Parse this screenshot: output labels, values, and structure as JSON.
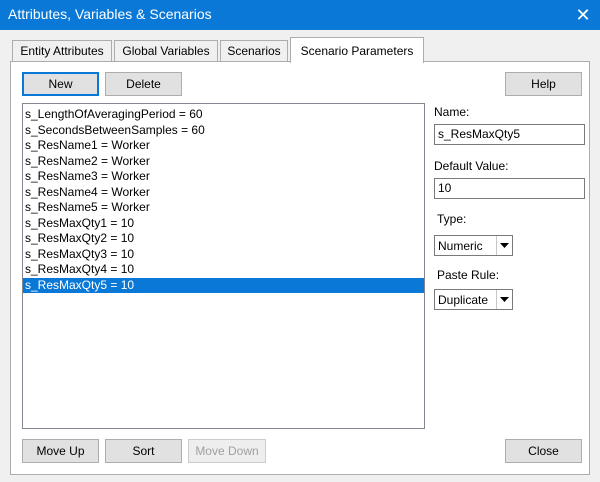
{
  "window": {
    "title": "Attributes, Variables & Scenarios",
    "close_glyph": "✕"
  },
  "tabs": [
    {
      "label": "Entity Attributes"
    },
    {
      "label": "Global Variables"
    },
    {
      "label": "Scenarios"
    },
    {
      "label": "Scenario Parameters",
      "active": true
    }
  ],
  "toolbar": {
    "new_label": "New",
    "delete_label": "Delete",
    "help_label": "Help"
  },
  "parameters": {
    "items": [
      "s_LengthOfAveragingPeriod = 60",
      "s_SecondsBetweenSamples = 60",
      "s_ResName1 = Worker",
      "s_ResName2 = Worker",
      "s_ResName3 = Worker",
      "s_ResName4 = Worker",
      "s_ResName5 = Worker",
      "s_ResMaxQty1 = 10",
      "s_ResMaxQty2 = 10",
      "s_ResMaxQty3 = 10",
      "s_ResMaxQty4 = 10",
      "s_ResMaxQty5 = 10"
    ],
    "selected_index": 11
  },
  "form": {
    "name_label": "Name:",
    "name_value": "s_ResMaxQty5",
    "default_label": "Default Value:",
    "default_value": "10",
    "type_label": "Type:",
    "type_value": "Numeric",
    "paste_label": "Paste Rule:",
    "paste_value": "Duplicate"
  },
  "footer": {
    "move_up_label": "Move Up",
    "sort_label": "Sort",
    "move_down_label": "Move Down",
    "close_label": "Close"
  },
  "colors": {
    "accent": "#0a78d7",
    "window_bg": "#f0f0f0"
  }
}
